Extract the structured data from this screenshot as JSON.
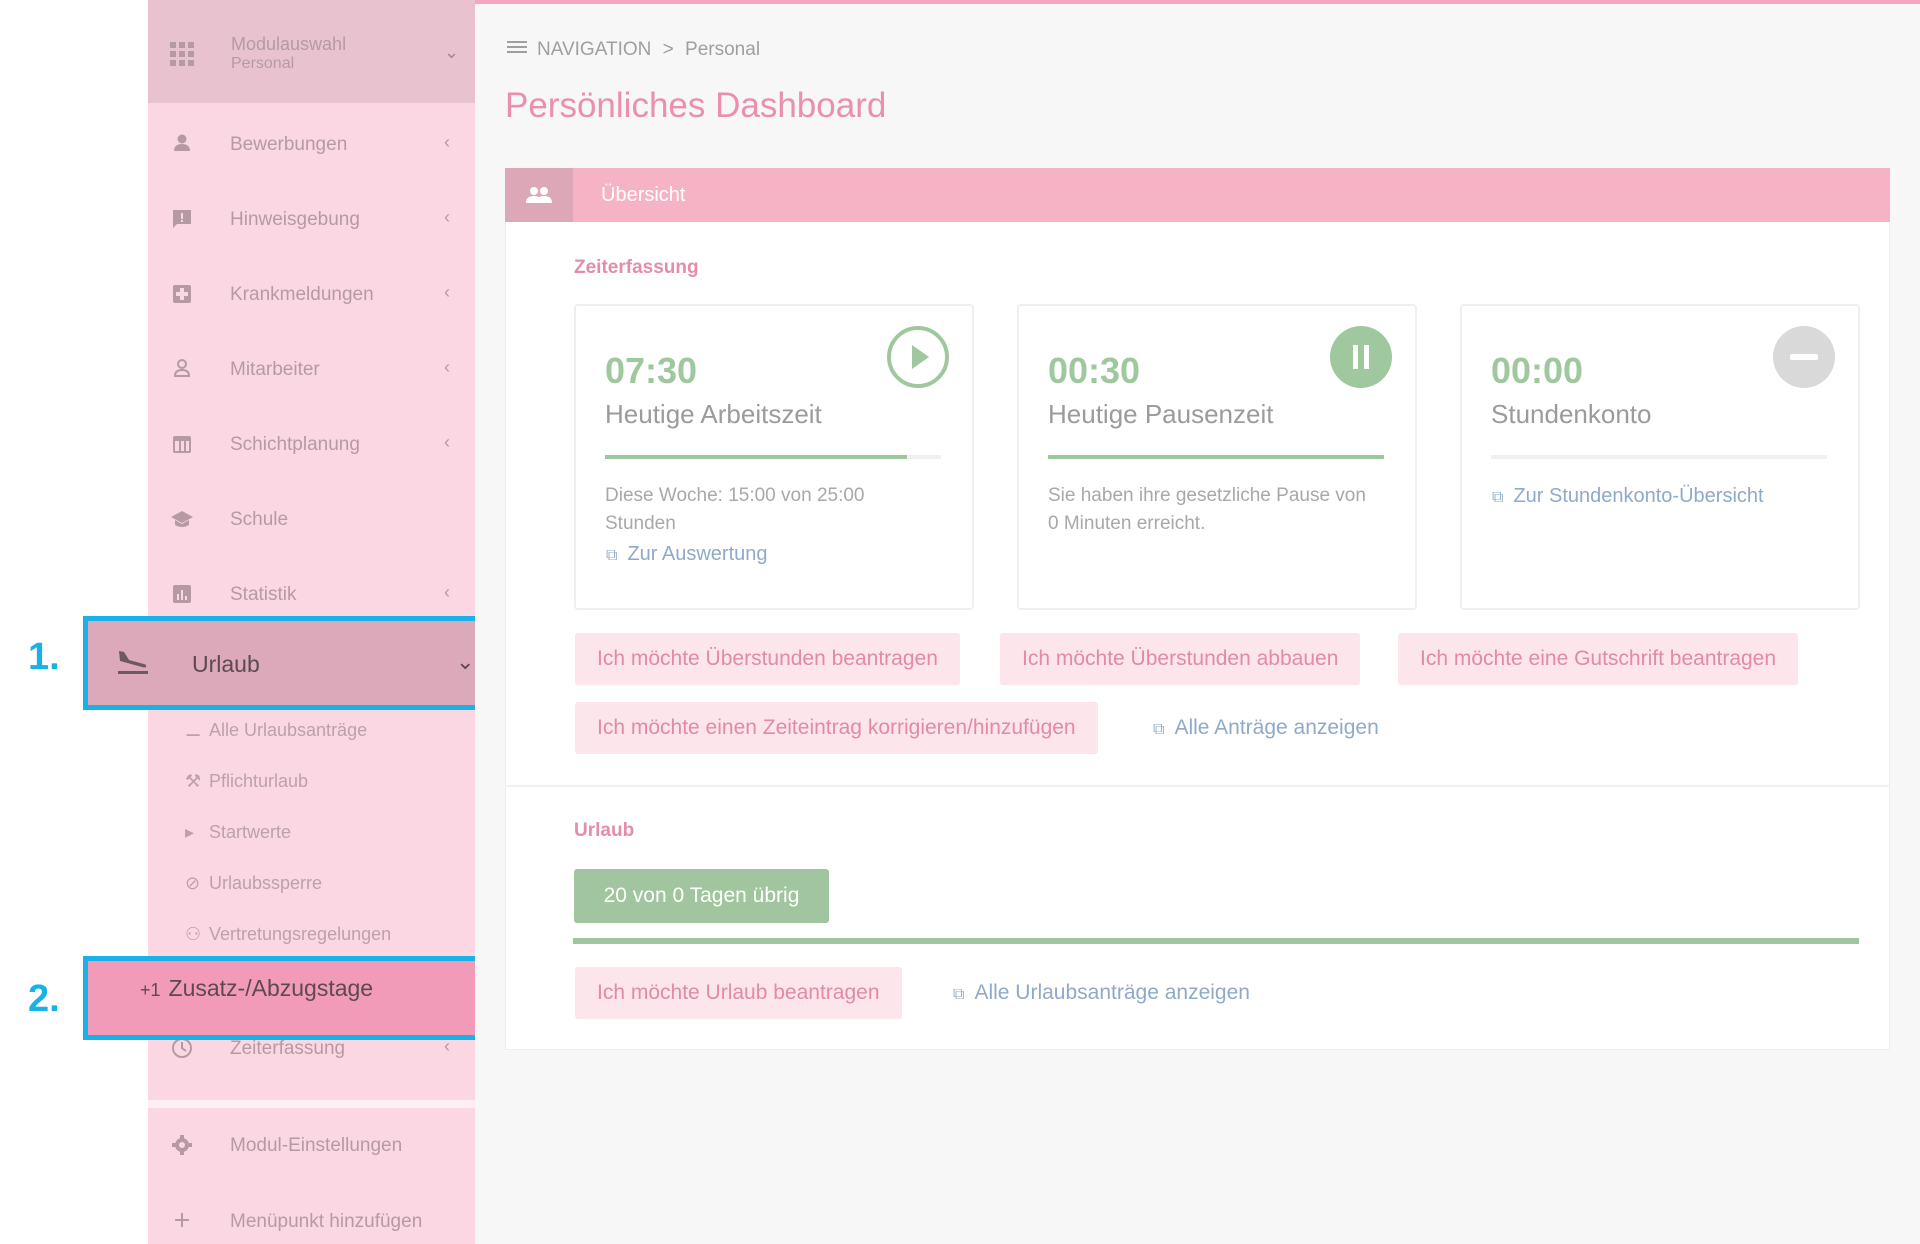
{
  "sidebar": {
    "module": {
      "title": "Modulauswahl",
      "subtitle": "Personal"
    },
    "items": [
      {
        "label": "Bewerbungen",
        "icon": "person-icon"
      },
      {
        "label": "Hinweisgebung",
        "icon": "feedback-icon"
      },
      {
        "label": "Krankmeldungen",
        "icon": "medical-icon"
      },
      {
        "label": "Mitarbeiter",
        "icon": "person-outline-icon"
      },
      {
        "label": "Schichtplanung",
        "icon": "calendar-icon"
      },
      {
        "label": "Schule",
        "icon": "school-icon"
      },
      {
        "label": "Statistik",
        "icon": "chart-icon"
      }
    ],
    "urlaub": {
      "label": "Urlaub",
      "icon": "flight-land-icon"
    },
    "urlaub_sub": [
      {
        "label": "Alle Urlaubsanträge",
        "icon": "flight-land-icon"
      },
      {
        "label": "Pflichturlaub",
        "icon": "gavel-icon"
      },
      {
        "label": "Startwerte",
        "icon": "play-icon"
      },
      {
        "label": "Urlaubssperre",
        "icon": "block-icon"
      },
      {
        "label": "Vertretungsregelungen",
        "icon": "people-icon"
      }
    ],
    "zusatz": {
      "prefix": "+1",
      "label": "Zusatz-/Abzugstage"
    },
    "zeiterfassung": {
      "label": "Zeiterfassung",
      "icon": "clock-icon"
    },
    "bottom_items": [
      {
        "label": "Modul-Einstellungen",
        "icon": "gear-icon"
      },
      {
        "label": "Menüpunkt hinzufügen",
        "icon": "plus-icon"
      }
    ]
  },
  "annotations": {
    "first": "1.",
    "second": "2."
  },
  "breadcrumb": {
    "root": "NAVIGATION",
    "separator": ">",
    "current": "Personal"
  },
  "page_title": "Persönliches Dashboard",
  "panel": {
    "title": "Übersicht",
    "zeit_section": "Zeiterfassung",
    "cards": [
      {
        "time": "07:30",
        "title": "Heutige Arbeitszeit",
        "progress": 0.9,
        "text": "Diese Woche: 15:00 von 25:00 Stunden",
        "link": "Zur Auswertung"
      },
      {
        "time": "00:30",
        "title": "Heutige Pausenzeit",
        "progress": 1.0,
        "text": "Sie haben ihre gesetzliche Pause von 0 Minuten erreicht."
      },
      {
        "time": "00:00",
        "title": "Stundenkonto",
        "progress": 0,
        "link": "Zur Stundenkonto-Übersicht"
      }
    ],
    "requests": {
      "overtime_request": "Ich möchte Überstunden beantragen",
      "overtime_reduce": "Ich möchte Überstunden abbauen",
      "credit_request": "Ich möchte eine Gutschrift beantragen",
      "correct_entry": "Ich möchte einen Zeiteintrag korrigieren/hinzufügen",
      "all_requests": "Alle Anträge anzeigen"
    },
    "urlaub_section": "Urlaub",
    "urlaub_badge": "20 von 0 Tagen übrig",
    "urlaub_request": "Ich möchte Urlaub beantragen",
    "urlaub_all": "Alle Urlaubsanträge anzeigen"
  },
  "colors": {
    "accent": "#ea90ae",
    "success": "#9fc89e",
    "link": "#8faac9",
    "highlight": "#19b2e6"
  }
}
